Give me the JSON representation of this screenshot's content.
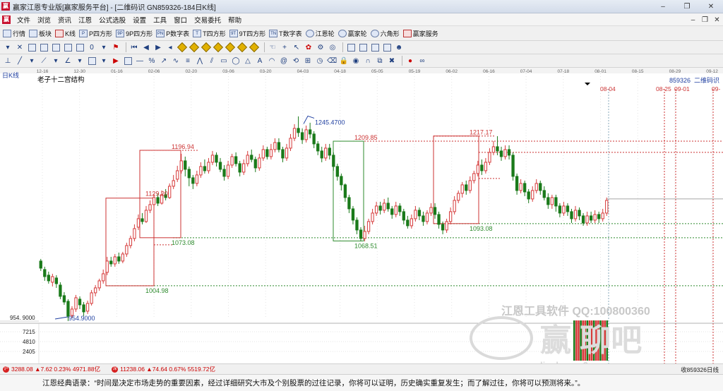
{
  "window": {
    "title": "赢家江恩专业版[赢家服务平台] - [二维码识  GN859326-184日K线]",
    "min": "–",
    "max": "❐",
    "close": "✕"
  },
  "menu": {
    "items": [
      "文件",
      "浏览",
      "资讯",
      "江恩",
      "公式选股",
      "设置",
      "工具",
      "窗口",
      "交易委托",
      "帮助"
    ]
  },
  "toolbar1": {
    "items": [
      {
        "icon": "grid-icon",
        "label": "行情"
      },
      {
        "icon": "blocks-icon",
        "label": "板块"
      },
      {
        "icon": "kline-icon",
        "label": "K线"
      },
      {
        "icon": "square-icon",
        "label": "P四方形",
        "badge": "P"
      },
      {
        "icon": "square-icon",
        "label": "9P四方形",
        "badge": "9P"
      },
      {
        "icon": "square-icon",
        "label": "P数字表",
        "badge": "PN"
      },
      {
        "icon": "square-icon",
        "label": "T四方形",
        "badge": "T"
      },
      {
        "icon": "square-icon",
        "label": "9T四方形",
        "badge": "9T"
      },
      {
        "icon": "square-icon",
        "label": "T数字表",
        "badge": "TN"
      },
      {
        "icon": "wheel-icon",
        "label": "江恩轮"
      },
      {
        "icon": "wheel-icon",
        "label": "赢家轮"
      },
      {
        "icon": "hexagon-icon",
        "label": "六角形"
      },
      {
        "icon": "dollar-icon",
        "label": "赢家服务"
      }
    ]
  },
  "chart_top": {
    "period": "日K线",
    "title": "老子十二宫结构",
    "code": "859326",
    "name": "二维码识"
  },
  "chart_data": {
    "type": "candlestick",
    "dates_axis": [
      "12-16",
      "12-30",
      "01-16",
      "02-06",
      "02-20",
      "03-06",
      "03-20",
      "04-03",
      "04-18",
      "05-05",
      "05-19",
      "06-02",
      "06-16",
      "07-04",
      "07-18",
      "08-01",
      "08-15",
      "08-29",
      "09-12"
    ],
    "annotations": [
      {
        "text": "1245.4700",
        "value": 1245.47
      },
      {
        "text": "1217.17",
        "value": 1217.17
      },
      {
        "text": "1209.85",
        "value": 1209.85
      },
      {
        "text": "1196.94",
        "value": 1196.94
      },
      {
        "text": "1129.20",
        "value": 1129.2
      },
      {
        "text": "1093.08",
        "value": 1093.08
      },
      {
        "text": "1073.08",
        "value": 1073.08
      },
      {
        "text": "1068.51",
        "value": 1068.51
      },
      {
        "text": "1004.98",
        "value": 1004.98
      },
      {
        "text": "954.9000",
        "value": 954.9
      }
    ],
    "y_tick": "954. 9000",
    "date_labels": [
      "08-04",
      "08-25",
      "09-01",
      "09-"
    ],
    "volume_ticks": [
      "7215",
      "4810",
      "2405"
    ],
    "bars_note": "approximate daily OHLC reconstructed visually",
    "bars": [
      [
        1040,
        1030,
        1043,
        1026
      ],
      [
        1028,
        1018,
        1032,
        1012
      ],
      [
        1020,
        1012,
        1025,
        1008
      ],
      [
        1010,
        1018,
        1022,
        1004
      ],
      [
        1016,
        1008,
        1020,
        1002
      ],
      [
        1006,
        990,
        1010,
        986
      ],
      [
        991,
        982,
        996,
        978
      ],
      [
        983,
        962,
        986,
        955
      ],
      [
        963,
        972,
        976,
        960
      ],
      [
        972,
        988,
        992,
        968
      ],
      [
        986,
        978,
        990,
        972
      ],
      [
        978,
        968,
        982,
        962
      ],
      [
        969,
        980,
        984,
        965
      ],
      [
        980,
        995,
        999,
        977
      ],
      [
        995,
        1002,
        1006,
        990
      ],
      [
        1002,
        1012,
        1015,
        998
      ],
      [
        1012,
        1022,
        1028,
        1008
      ],
      [
        1024,
        1040,
        1046,
        1020
      ],
      [
        1040,
        1036,
        1046,
        1032
      ],
      [
        1036,
        1046,
        1050,
        1032
      ],
      [
        1046,
        1040,
        1052,
        1036
      ],
      [
        1040,
        1050,
        1053,
        1037
      ],
      [
        1050,
        1062,
        1066,
        1046
      ],
      [
        1062,
        1072,
        1076,
        1058
      ],
      [
        1072,
        1086,
        1092,
        1068
      ],
      [
        1088,
        1100,
        1106,
        1084
      ],
      [
        1100,
        1096,
        1108,
        1092
      ],
      [
        1096,
        1112,
        1118,
        1094
      ],
      [
        1112,
        1120,
        1126,
        1108
      ],
      [
        1120,
        1130,
        1135,
        1115
      ],
      [
        1130,
        1122,
        1136,
        1118
      ],
      [
        1122,
        1134,
        1140,
        1120
      ],
      [
        1134,
        1130,
        1142,
        1126
      ],
      [
        1130,
        1146,
        1150,
        1128
      ],
      [
        1146,
        1154,
        1162,
        1142
      ],
      [
        1156,
        1168,
        1175,
        1152
      ],
      [
        1168,
        1182,
        1192,
        1164
      ],
      [
        1182,
        1170,
        1188,
        1160
      ],
      [
        1170,
        1158,
        1174,
        1146
      ],
      [
        1158,
        1150,
        1162,
        1142
      ],
      [
        1150,
        1162,
        1168,
        1146
      ],
      [
        1162,
        1174,
        1180,
        1158
      ],
      [
        1174,
        1168,
        1184,
        1164
      ],
      [
        1168,
        1180,
        1186,
        1164
      ],
      [
        1180,
        1190,
        1196,
        1176
      ],
      [
        1190,
        1180,
        1194,
        1174
      ],
      [
        1180,
        1170,
        1186,
        1166
      ],
      [
        1170,
        1160,
        1176,
        1154
      ],
      [
        1160,
        1176,
        1182,
        1156
      ],
      [
        1176,
        1188,
        1192,
        1172
      ],
      [
        1188,
        1178,
        1194,
        1174
      ],
      [
        1178,
        1166,
        1182,
        1160
      ],
      [
        1166,
        1178,
        1184,
        1162
      ],
      [
        1178,
        1190,
        1196,
        1174
      ],
      [
        1190,
        1184,
        1198,
        1180
      ],
      [
        1184,
        1172,
        1188,
        1166
      ],
      [
        1172,
        1186,
        1192,
        1168
      ],
      [
        1186,
        1198,
        1204,
        1182
      ],
      [
        1198,
        1188,
        1202,
        1184
      ],
      [
        1188,
        1198,
        1206,
        1184
      ],
      [
        1198,
        1208,
        1214,
        1194
      ],
      [
        1208,
        1198,
        1214,
        1194
      ],
      [
        1198,
        1186,
        1202,
        1180
      ],
      [
        1186,
        1200,
        1206,
        1182
      ],
      [
        1200,
        1214,
        1220,
        1196
      ],
      [
        1214,
        1228,
        1234,
        1210
      ],
      [
        1228,
        1222,
        1245,
        1216
      ],
      [
        1222,
        1212,
        1228,
        1206
      ],
      [
        1212,
        1226,
        1232,
        1208
      ],
      [
        1226,
        1220,
        1236,
        1214
      ],
      [
        1220,
        1206,
        1224,
        1200
      ],
      [
        1206,
        1196,
        1210,
        1190
      ],
      [
        1196,
        1186,
        1202,
        1180
      ],
      [
        1186,
        1200,
        1206,
        1182
      ],
      [
        1200,
        1190,
        1206,
        1184
      ],
      [
        1190,
        1174,
        1194,
        1168
      ],
      [
        1174,
        1160,
        1178,
        1154
      ],
      [
        1160,
        1148,
        1164,
        1140
      ],
      [
        1148,
        1130,
        1150,
        1124
      ],
      [
        1130,
        1114,
        1134,
        1108
      ],
      [
        1114,
        1098,
        1118,
        1092
      ],
      [
        1098,
        1084,
        1102,
        1078
      ],
      [
        1084,
        1072,
        1088,
        1068
      ],
      [
        1072,
        1082,
        1090,
        1068
      ],
      [
        1082,
        1096,
        1100,
        1078
      ],
      [
        1096,
        1108,
        1114,
        1092
      ],
      [
        1108,
        1118,
        1124,
        1104
      ],
      [
        1118,
        1112,
        1124,
        1106
      ],
      [
        1112,
        1122,
        1128,
        1108
      ],
      [
        1122,
        1114,
        1130,
        1110
      ],
      [
        1114,
        1106,
        1118,
        1100
      ],
      [
        1106,
        1118,
        1124,
        1102
      ],
      [
        1118,
        1110,
        1122,
        1104
      ],
      [
        1110,
        1098,
        1114,
        1092
      ],
      [
        1098,
        1090,
        1104,
        1086
      ],
      [
        1090,
        1100,
        1106,
        1086
      ],
      [
        1100,
        1112,
        1118,
        1096
      ],
      [
        1112,
        1104,
        1116,
        1098
      ],
      [
        1104,
        1096,
        1110,
        1090
      ],
      [
        1096,
        1108,
        1112,
        1092
      ],
      [
        1108,
        1116,
        1122,
        1104
      ],
      [
        1116,
        1106,
        1122,
        1100
      ],
      [
        1106,
        1092,
        1110,
        1086
      ],
      [
        1092,
        1084,
        1096,
        1078
      ],
      [
        1084,
        1096,
        1100,
        1080
      ],
      [
        1096,
        1110,
        1116,
        1092
      ],
      [
        1110,
        1126,
        1132,
        1106
      ],
      [
        1126,
        1136,
        1140,
        1122
      ],
      [
        1136,
        1148,
        1152,
        1130
      ],
      [
        1148,
        1140,
        1154,
        1134
      ],
      [
        1140,
        1154,
        1160,
        1136
      ],
      [
        1154,
        1164,
        1168,
        1150
      ],
      [
        1164,
        1176,
        1182,
        1160
      ],
      [
        1176,
        1168,
        1184,
        1162
      ],
      [
        1168,
        1180,
        1186,
        1164
      ],
      [
        1180,
        1194,
        1200,
        1176
      ],
      [
        1194,
        1202,
        1210,
        1190
      ],
      [
        1202,
        1196,
        1217,
        1190
      ],
      [
        1196,
        1188,
        1202,
        1182
      ],
      [
        1188,
        1198,
        1204,
        1184
      ],
      [
        1198,
        1190,
        1204,
        1184
      ],
      [
        1190,
        1160,
        1194,
        1154
      ],
      [
        1160,
        1140,
        1164,
        1134
      ],
      [
        1140,
        1150,
        1156,
        1136
      ],
      [
        1150,
        1138,
        1154,
        1132
      ],
      [
        1138,
        1128,
        1142,
        1122
      ],
      [
        1128,
        1140,
        1146,
        1124
      ],
      [
        1140,
        1150,
        1156,
        1136
      ],
      [
        1150,
        1140,
        1154,
        1134
      ],
      [
        1140,
        1130,
        1146,
        1126
      ],
      [
        1130,
        1120,
        1136,
        1114
      ],
      [
        1120,
        1130,
        1134,
        1114
      ],
      [
        1130,
        1118,
        1134,
        1110
      ],
      [
        1118,
        1108,
        1122,
        1102
      ],
      [
        1108,
        1118,
        1124,
        1104
      ],
      [
        1118,
        1110,
        1122,
        1104
      ],
      [
        1110,
        1100,
        1114,
        1094
      ],
      [
        1100,
        1112,
        1118,
        1096
      ],
      [
        1112,
        1104,
        1116,
        1098
      ],
      [
        1104,
        1094,
        1108,
        1090
      ],
      [
        1094,
        1104,
        1110,
        1090
      ],
      [
        1104,
        1098,
        1110,
        1094
      ],
      [
        1098,
        1106,
        1112,
        1094
      ],
      [
        1106,
        1100,
        1110,
        1094
      ],
      [
        1100,
        1108,
        1114,
        1096
      ],
      [
        1108,
        1126,
        1130,
        1104
      ]
    ]
  },
  "status": {
    "idx1_badge": "沪",
    "idx1": "3288.08 ▲7.62 0.23% 4971.88亿",
    "idx2_badge": "深",
    "idx2": "11238.06 ▲74.64 0.67% 5519.72亿",
    "right": "收859326日线"
  },
  "quote": {
    "text": "江恩经典语录：“时间是决定市场走势的重要因素，经过详细研究大市及个别股票的过往记录，你将可以证明，历史确实重复发生；而了解过往，你将可以预测将来。”。"
  },
  "watermarks": {
    "tools": "江恩工具软件   QQ:100800360",
    "forum": "赢 聊吧",
    "site": "liaoba.yxr3..."
  },
  "colors": {
    "up": "#d63a3a",
    "down": "#1a7a1a",
    "box": "#cc3333",
    "level": "#2e8b2e",
    "grid": "#e4e4e4"
  }
}
